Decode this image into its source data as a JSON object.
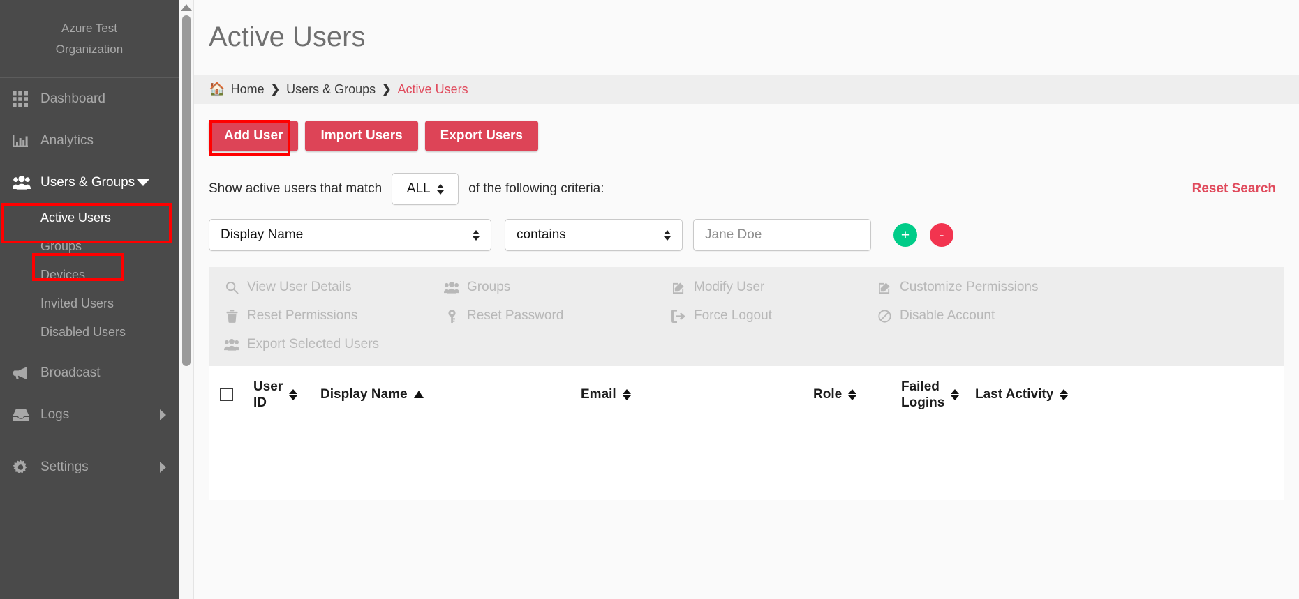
{
  "sidebar": {
    "org_line1": "Azure Test",
    "org_line2": "Organization",
    "items": [
      {
        "label": "Dashboard",
        "icon": "grid-icon"
      },
      {
        "label": "Analytics",
        "icon": "bar-chart-icon"
      },
      {
        "label": "Users & Groups",
        "icon": "users-icon"
      },
      {
        "label": "Broadcast",
        "icon": "megaphone-icon"
      },
      {
        "label": "Logs",
        "icon": "inbox-icon"
      },
      {
        "label": "Settings",
        "icon": "gear-icon"
      }
    ],
    "sub_items": [
      {
        "label": "Active Users"
      },
      {
        "label": "Groups"
      },
      {
        "label": "Devices"
      },
      {
        "label": "Invited Users"
      },
      {
        "label": "Disabled Users"
      }
    ]
  },
  "header": {
    "title": "Active Users"
  },
  "breadcrumb": {
    "home": "Home",
    "parent": "Users & Groups",
    "current": "Active Users",
    "separator": "❯"
  },
  "toolbar": {
    "add_user": "Add User",
    "import_users": "Import Users",
    "export_users": "Export Users"
  },
  "filter": {
    "prefix_text": "Show active users that match",
    "match_mode": "ALL",
    "suffix_text": "of the following criteria:",
    "reset_search": "Reset Search",
    "criteria": {
      "field": "Display Name",
      "operator": "contains",
      "value": "",
      "value_placeholder": "Jane Doe"
    },
    "add_criterion": "+",
    "remove_criterion": "-"
  },
  "actions": [
    {
      "label": "View User Details",
      "icon": "search-icon"
    },
    {
      "label": "Groups",
      "icon": "users-icon"
    },
    {
      "label": "Modify User",
      "icon": "edit-icon"
    },
    {
      "label": "Customize Permissions",
      "icon": "edit-icon"
    },
    {
      "label": "Reset Permissions",
      "icon": "trash-icon"
    },
    {
      "label": "Reset Password",
      "icon": "key-icon"
    },
    {
      "label": "Force Logout",
      "icon": "logout-icon"
    },
    {
      "label": "Disable Account",
      "icon": "ban-icon"
    },
    {
      "label": "Export Selected Users",
      "icon": "users-icon"
    }
  ],
  "table": {
    "columns": [
      {
        "label": "User ID",
        "sort": "both"
      },
      {
        "label": "Display Name",
        "sort": "asc"
      },
      {
        "label": "Email",
        "sort": "both"
      },
      {
        "label": "Role",
        "sort": "both"
      },
      {
        "label": "Failed Logins",
        "sort": "both"
      },
      {
        "label": "Last Activity",
        "sort": "both"
      }
    ],
    "rows": []
  },
  "colors": {
    "accent_red": "#dd4457",
    "link_red": "#e04a5c",
    "sidebar_bg": "#4a4a4a",
    "add_green": "#00cc88",
    "remove_red": "#f2344f",
    "highlight_border": "#ff0000"
  }
}
